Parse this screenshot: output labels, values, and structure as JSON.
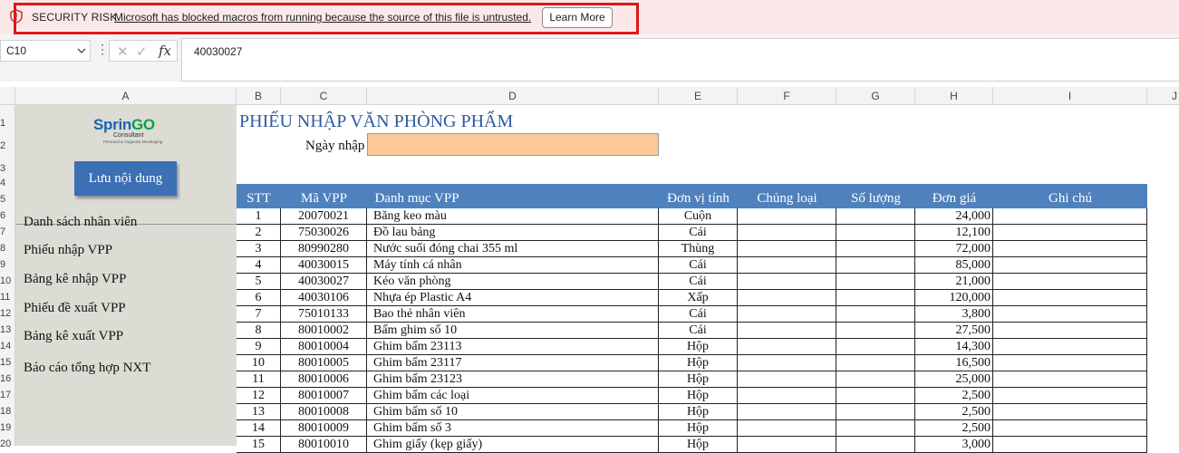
{
  "security_bar": {
    "title": "SECURITY RISK",
    "message": "Microsoft has blocked macros from running because the source of this file is untrusted.",
    "learn_more": "Learn More"
  },
  "formula_bar": {
    "name_box": "C10",
    "fx_label": "fx",
    "value": "40030027"
  },
  "columns": [
    "A",
    "B",
    "C",
    "D",
    "E",
    "F",
    "G",
    "H",
    "I",
    "J"
  ],
  "rows": [
    "1",
    "2",
    "3",
    "4",
    "5",
    "6",
    "7",
    "8",
    "9",
    "10",
    "11",
    "12",
    "13",
    "14",
    "15",
    "16",
    "17",
    "18",
    "19",
    "20"
  ],
  "sidebar": {
    "logo_main": "SprinGO",
    "logo_sub": "Consultant",
    "logo_tag": "Personal & Organize Developing",
    "save_button": "Lưu nội dung",
    "links": [
      "Danh sách nhân viên",
      "Phiếu nhập VPP",
      "Bảng kê nhập VPP",
      "Phiếu đề xuất VPP",
      "Bảng kê xuất VPP",
      "Báo cáo tổng hợp NXT"
    ]
  },
  "sheet": {
    "title": "PHIẾU NHẬP VĂN PHÒNG PHẨM",
    "date_label": "Ngày nhập",
    "date_value": ""
  },
  "table": {
    "headers": [
      "STT",
      "Mã VPP",
      "Danh mục VPP",
      "Đơn vị tính",
      "Chủng loại",
      "Số lượng",
      "Đơn giá",
      "Ghi chú"
    ],
    "rows": [
      [
        "1",
        "20070021",
        "Băng keo màu",
        "Cuộn",
        "",
        "",
        "24,000",
        ""
      ],
      [
        "2",
        "75030026",
        "Đồ lau bảng",
        "Cái",
        "",
        "",
        "12,100",
        ""
      ],
      [
        "3",
        "80990280",
        "Nước suối đóng chai 355 ml",
        "Thùng",
        "",
        "",
        "72,000",
        ""
      ],
      [
        "4",
        "40030015",
        "Máy tính cá nhân",
        "Cái",
        "",
        "",
        "85,000",
        ""
      ],
      [
        "5",
        "40030027",
        "Kéo văn phòng",
        "Cái",
        "",
        "",
        "21,000",
        ""
      ],
      [
        "6",
        "40030106",
        "Nhựa ép Plastic A4",
        "Xấp",
        "",
        "",
        "120,000",
        ""
      ],
      [
        "7",
        "75010133",
        "Bao thẻ nhân viên",
        "Cái",
        "",
        "",
        "3,800",
        ""
      ],
      [
        "8",
        "80010002",
        "Bấm ghim số 10",
        "Cái",
        "",
        "",
        "27,500",
        ""
      ],
      [
        "9",
        "80010004",
        "Ghim bấm 23113",
        "Hộp",
        "",
        "",
        "14,300",
        ""
      ],
      [
        "10",
        "80010005",
        "Ghim bấm 23117",
        "Hộp",
        "",
        "",
        "16,500",
        ""
      ],
      [
        "11",
        "80010006",
        "Ghim bấm 23123",
        "Hộp",
        "",
        "",
        "25,000",
        ""
      ],
      [
        "12",
        "80010007",
        "Ghim bấm các loại",
        "Hộp",
        "",
        "",
        "2,500",
        ""
      ],
      [
        "13",
        "80010008",
        "Ghim bấm số 10",
        "Hộp",
        "",
        "",
        "2,500",
        ""
      ],
      [
        "14",
        "80010009",
        "Ghim bấm số 3",
        "Hộp",
        "",
        "",
        "2,500",
        ""
      ],
      [
        "15",
        "80010010",
        "Ghim giấy (kẹp giấy)",
        "Hộp",
        "",
        "",
        "3,000",
        ""
      ]
    ]
  },
  "colors": {
    "security_bg": "#fbe9ea",
    "highlight_border": "#e0171a",
    "table_header": "#4f81bd",
    "title_blue": "#2e5a9c",
    "date_fill": "#fdc89a",
    "sidebar_bg": "#dcdcd4",
    "button_blue": "#3c6fb4"
  }
}
